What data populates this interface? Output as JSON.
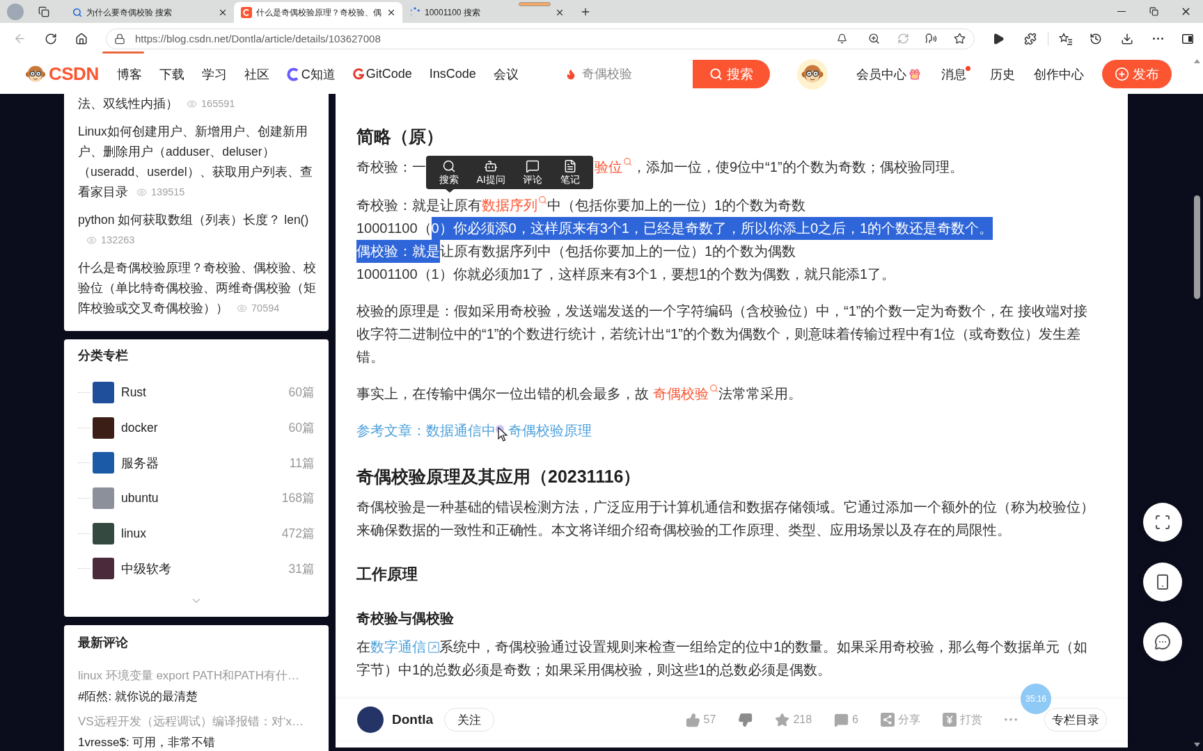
{
  "browser": {
    "tabs": [
      {
        "kind": "search",
        "title": "为什么要奇偶校验 搜索",
        "selected": false
      },
      {
        "kind": "site",
        "title": "什么是奇偶校验原理？奇校验、偶",
        "selected": true
      },
      {
        "kind": "loading",
        "title": "10001100 搜索",
        "selected": false
      }
    ],
    "url": "https://blog.csdn.net/Dontla/article/details/103627008"
  },
  "site_header": {
    "logo": "CSDN",
    "nav": [
      {
        "kind": "plain",
        "label": "博客"
      },
      {
        "kind": "plain",
        "label": "下载"
      },
      {
        "kind": "plain",
        "label": "学习"
      },
      {
        "kind": "plain",
        "label": "社区"
      },
      {
        "kind": "cknow",
        "label": "C知道"
      },
      {
        "kind": "gitcode",
        "label": "GitCode"
      },
      {
        "kind": "plain",
        "label": "InsCode"
      },
      {
        "kind": "plain",
        "label": "会议"
      }
    ],
    "search": {
      "placeholder": "奇偶校验",
      "button": "搜索"
    },
    "user_links": [
      {
        "kind": "gift",
        "label": "会员中心",
        "unread": false
      },
      {
        "kind": "plain",
        "label": "消息",
        "unread": true
      },
      {
        "kind": "plain",
        "label": "历史",
        "unread": false
      },
      {
        "kind": "plain",
        "label": "创作中心",
        "unread": false
      }
    ],
    "publish": "发布"
  },
  "sidebar": {
    "popular": [
      {
        "title": "法、双线性内插）",
        "views": "165591"
      },
      {
        "title": "Linux如何创建用户、新增用户、创建新用户、删除用户（adduser、deluser）（useradd、userdel）、获取用户列表、查看家目录",
        "views": "139515"
      },
      {
        "title": "python 如何获取数组（列表）长度？ len()",
        "views": "132263"
      },
      {
        "title": "什么是奇偶校验原理？奇校验、偶校验、校验位（单比特奇偶校验、两维奇偶校验（矩阵校验或交叉奇偶校验））",
        "views": "70594"
      }
    ],
    "categories": {
      "title": "分类专栏",
      "items": [
        {
          "name": "Rust",
          "count": "60篇",
          "color": "#1f4f9a"
        },
        {
          "name": "docker",
          "count": "60篇",
          "color": "#3b1f16"
        },
        {
          "name": "服务器",
          "count": "11篇",
          "color": "#1b5aa6"
        },
        {
          "name": "ubuntu",
          "count": "168篇",
          "color": "#8b909b"
        },
        {
          "name": "linux",
          "count": "472篇",
          "color": "#344a40"
        },
        {
          "name": "中级软考",
          "count": "31篇",
          "color": "#4b2b3b"
        }
      ]
    },
    "comments": {
      "title": "最新评论",
      "items": [
        {
          "article": "linux 环境变量 export PATH和PATH有什…",
          "comment": "#陌然: 就你说的最清楚"
        },
        {
          "article": "VS远程开发（远程调试）编译报错：对‘x…",
          "comment": "1vresse$: 可用，非常不错"
        }
      ]
    }
  },
  "article": {
    "blocks": [
      {
        "kind": "h2",
        "text": "简略（原）"
      },
      {
        "kind": "paragraph",
        "parts": [
          {
            "kind": "text",
            "text": "奇校验：一"
          },
          {
            "kind": "toolbar",
            "items": [
              {
                "kind": "search",
                "label": "搜索"
              },
              {
                "kind": "ai",
                "label": "AI提问"
              },
              {
                "kind": "comment",
                "label": "评论"
              },
              {
                "kind": "note",
                "label": "笔记"
              }
            ]
          },
          {
            "kind": "search_link",
            "text": "验位"
          },
          {
            "kind": "text",
            "text": "，添加一位，使9位中“1”的个数为奇数；偶校验同理。"
          }
        ]
      },
      {
        "kind": "lines",
        "lines": [
          [
            {
              "kind": "text",
              "text": "奇校验：就是让原有",
              "highlighted": false
            },
            {
              "kind": "search_link",
              "text": "数据序列",
              "highlighted": false
            },
            {
              "kind": "text",
              "text": "中（包括你要加上的一位）1的个数为奇数",
              "highlighted": false
            }
          ],
          [
            {
              "kind": "text",
              "text": "10001100（",
              "highlighted": false
            },
            {
              "kind": "text",
              "text": "0）你必须添0，这样原来有3个1，已经是奇数了，所以你添上0之后，1的个数还是奇数个。",
              "highlighted": true
            }
          ],
          [
            {
              "kind": "text",
              "text": "偶校验：就是",
              "highlighted": true
            },
            {
              "kind": "text",
              "text": "让原有数据序列中（包括你要加上的一位）1的个数为偶数",
              "highlighted": false
            }
          ],
          [
            {
              "kind": "text",
              "text": "10001100（1）你就必须加1了，这样原来有3个1，要想1的个数为偶数，就只能添1了。",
              "highlighted": false
            }
          ]
        ]
      },
      {
        "kind": "paragraph",
        "parts": [
          {
            "kind": "text",
            "text": "校验的原理是：假如采用奇校验，发送端发送的一个字符编码（含校验位）中，“1”的个数一定为奇数个，在 接收端对接收字符二进制位中的“1”的个数进行统计，若统计出“1”的个数为偶数个，则意味着传输过程中有1位（或奇数位）发生差错。"
          }
        ]
      },
      {
        "kind": "paragraph",
        "parts": [
          {
            "kind": "text",
            "text": "事实上，在传输中偶尔一位出错的机会最多，故 "
          },
          {
            "kind": "search_link",
            "text": "奇偶校验"
          },
          {
            "kind": "text",
            "text": "法常常采用。"
          }
        ]
      },
      {
        "kind": "references",
        "label": "参考文章：",
        "links": [
          "数据通信中",
          "奇偶校验原理"
        ]
      },
      {
        "kind": "h2",
        "text": "奇偶校验原理及其应用（20231116）"
      },
      {
        "kind": "paragraph",
        "parts": [
          {
            "kind": "text",
            "text": "奇偶校验是一种基础的错误检测方法，广泛应用于计算机通信和数据存储领域。它通过添加一个额外的位（称为校验位）来确保数据的一致性和正确性。本文将详细介绍奇偶校验的工作原理、类型、应用场景以及存在的局限性。"
          }
        ]
      },
      {
        "kind": "h3",
        "text": "工作原理"
      },
      {
        "kind": "h4",
        "text": "奇校验与偶校验"
      },
      {
        "kind": "paragraph",
        "parts": [
          {
            "kind": "text",
            "text": "在"
          },
          {
            "kind": "ext_link",
            "text": "数字通信"
          },
          {
            "kind": "text",
            "text": "系统中，奇偶校验通过设置规则来检查一组给定的位中1的数量。如果采用奇校验，那么每个数据单元（如字节）中1的总数必须是奇数；如果采用偶校验，则这些1的总数必须是偶数。"
          }
        ]
      }
    ]
  },
  "article_bar": {
    "author": "Dontla",
    "follow": "关注",
    "actions": [
      {
        "kind": "like",
        "text": "57"
      },
      {
        "kind": "dislike"
      },
      {
        "kind": "favorite",
        "text": "218"
      },
      {
        "kind": "comment",
        "text": "6"
      },
      {
        "kind": "share",
        "text": "分享"
      },
      {
        "kind": "reward",
        "text": "打赏"
      },
      {
        "kind": "more"
      }
    ],
    "toc": "专栏目录"
  },
  "timer": "35:16"
}
